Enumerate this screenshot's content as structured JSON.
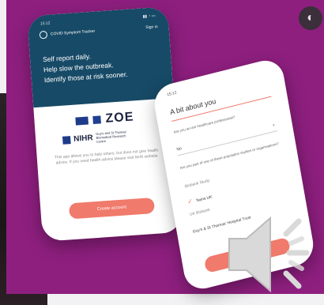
{
  "phone1": {
    "status_time": "15:12",
    "app_name": "COVID Symptom Tracker",
    "sign_in": "Sign in",
    "hero_lines": [
      "Self report daily.",
      "Help slow the outbreak.",
      "Identify those at risk sooner."
    ],
    "brand": "ZOE",
    "nihr": "NIHR",
    "nihr_sub": "Guy's and St Thomas' Biomedical Research Centre",
    "disclaimer": "This app allows you to help others, but does not give health advice. If you need health advice please visit NHS website",
    "cta": "Create account"
  },
  "phone2": {
    "status_time": "15:12",
    "title": "A bit about you",
    "q1": "Are you an are healthcare professional?",
    "q1_value": "No",
    "q2": "Are you part of one of these population studies or organisations?",
    "options": [
      "Biobank Study",
      "Twins UK",
      "UK Biobank"
    ],
    "checked_index": 1,
    "trust": "Guy's & St Thomas' Hospital Trust",
    "cta": "Next question"
  },
  "colors": {
    "accent": "#f07a6b",
    "purple": "#8e1f7f",
    "header": "#174a66"
  },
  "icons": {
    "speaker": "speaker-volume-icon",
    "corner": "overlay-button-icon"
  }
}
